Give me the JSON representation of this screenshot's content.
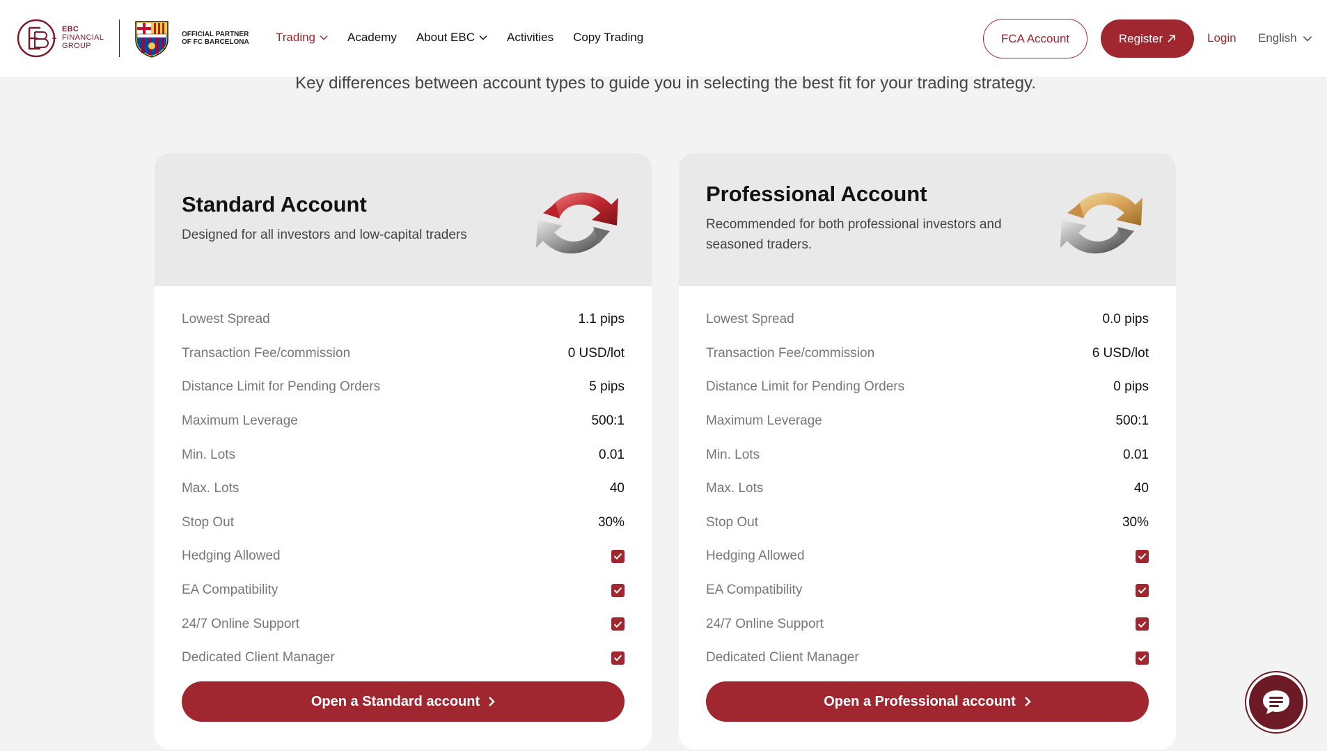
{
  "header": {
    "brand": {
      "line1": "EBC",
      "line2": "FINANCIAL",
      "line3": "GROUP"
    },
    "partner": {
      "line1": "OFFICIAL PARTNER",
      "line2": "OF FC BARCELONA"
    },
    "nav": [
      {
        "label": "Trading",
        "has_dropdown": true,
        "active": true
      },
      {
        "label": "Academy",
        "has_dropdown": false
      },
      {
        "label": "About EBC",
        "has_dropdown": true
      },
      {
        "label": "Activities",
        "has_dropdown": false
      },
      {
        "label": "Copy Trading",
        "has_dropdown": false
      }
    ],
    "fca_button": "FCA Account",
    "register_button": "Register",
    "login_link": "Login",
    "language": "English"
  },
  "subtitle": "Key differences between account types to guide you in selecting the best fit for your trading strategy.",
  "cards": [
    {
      "title": "Standard Account",
      "description": "Designed for all investors and low-capital traders",
      "icon": "refresh-arrows-red-icon",
      "rows": [
        {
          "label": "Lowest Spread",
          "value": "1.1 pips"
        },
        {
          "label": "Transaction Fee/commission",
          "value": "0 USD/lot"
        },
        {
          "label": "Distance Limit for Pending Orders",
          "value": "5 pips"
        },
        {
          "label": "Maximum Leverage",
          "value": "500:1"
        },
        {
          "label": "Min. Lots",
          "value": "0.01"
        },
        {
          "label": "Max. Lots",
          "value": "40"
        },
        {
          "label": "Stop Out",
          "value": "30%"
        }
      ],
      "checks": [
        {
          "label": "Hedging Allowed",
          "checked": true
        },
        {
          "label": "EA Compatibility",
          "checked": true
        },
        {
          "label": "24/7 Online Support",
          "checked": true
        },
        {
          "label": "Dedicated Client Manager",
          "checked": true
        }
      ],
      "cta": "Open a Standard account"
    },
    {
      "title": "Professional Account",
      "description": "Recommended for both professional investors and seasoned traders.",
      "icon": "refresh-arrows-gold-icon",
      "rows": [
        {
          "label": "Lowest Spread",
          "value": "0.0 pips"
        },
        {
          "label": "Transaction Fee/commission",
          "value": "6 USD/lot"
        },
        {
          "label": "Distance Limit for Pending Orders",
          "value": "0 pips"
        },
        {
          "label": "Maximum Leverage",
          "value": "500:1"
        },
        {
          "label": "Min. Lots",
          "value": "0.01"
        },
        {
          "label": "Max. Lots",
          "value": "40"
        },
        {
          "label": "Stop Out",
          "value": "30%"
        }
      ],
      "checks": [
        {
          "label": "Hedging Allowed",
          "checked": true
        },
        {
          "label": "EA Compatibility",
          "checked": true
        },
        {
          "label": "24/7 Online Support",
          "checked": true
        },
        {
          "label": "Dedicated Client Manager",
          "checked": true
        }
      ],
      "cta": "Open a Professional account"
    }
  ],
  "colors": {
    "brand": "#a0262f",
    "brand_dark": "#6d1a27",
    "card_header": "#e9e9e9",
    "page_bg": "#f3f3f3"
  },
  "chat_icon": "chat-bubble-icon"
}
